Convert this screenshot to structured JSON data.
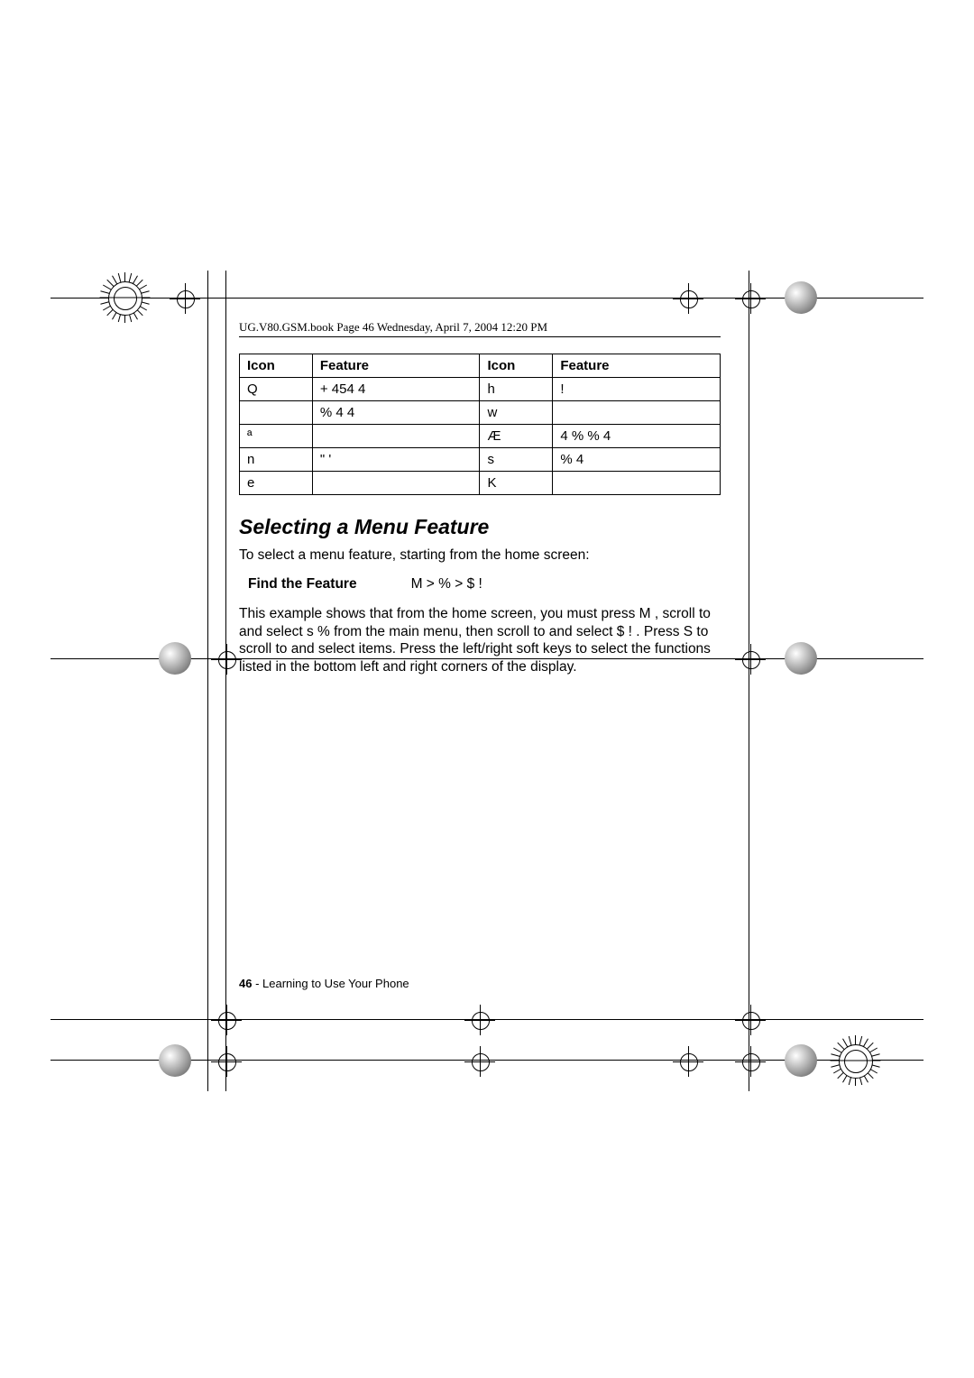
{
  "header_text": "UG.V80.GSM.book  Page 46  Wednesday, April 7, 2004  12:20 PM",
  "table": {
    "headers": [
      "Icon",
      "Feature",
      "Icon",
      "Feature"
    ],
    "rows": [
      {
        "icon1": "Q",
        "feat1": "+   454   4",
        "icon2": "h",
        "feat2": "!"
      },
      {
        "icon1": "",
        "feat1": "% 4    4",
        "icon2": "w",
        "feat2": ""
      },
      {
        "icon1": "ª",
        "feat1": "",
        "icon2": "Æ",
        "feat2": "4 % %  4"
      },
      {
        "icon1": "n",
        "feat1": "\"    '",
        "icon2": "s",
        "feat2": "%   4"
      },
      {
        "icon1": "e",
        "feat1": "",
        "icon2": "K",
        "feat2": ""
      }
    ]
  },
  "section_title": "Selecting a Menu Feature",
  "intro_text": "To select a menu feature, starting from the home screen:",
  "find_label": "Find the Feature",
  "find_path": "M   >  %         > $     !",
  "paragraph": "This example shows that from the home screen, you must press M , scroll to and select s    %        from the main menu, then scroll to and select $     ! . Press S  to scroll to and select items. Press the left/right soft keys to select the functions listed in the bottom left and right corners of the display.",
  "footer_page": "46",
  "footer_text": " - Learning to Use Your Phone"
}
